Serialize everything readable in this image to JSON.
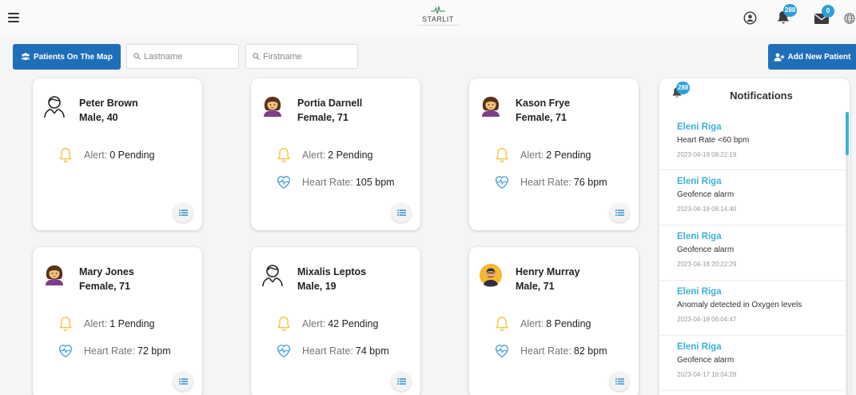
{
  "app": {
    "logo_text": "STARLIT"
  },
  "header": {
    "notifications_count": "288",
    "messages_count": "0"
  },
  "toolbar": {
    "map_button_label": "Patients On The Map",
    "lastname_placeholder": "Lastname",
    "firstname_placeholder": "Firstname",
    "add_patient_label": "Add New Patient"
  },
  "labels": {
    "alert": "Alert:",
    "heart_rate": "Heart Rate:"
  },
  "patients": [
    {
      "name": "Peter Brown",
      "gender_age": "Male, 40",
      "avatar": "outline-user-icon",
      "alert": "0 Pending",
      "heart_rate": ""
    },
    {
      "name": "Portia Darnell",
      "gender_age": "Female, 71",
      "avatar": "female-avatar-icon",
      "alert": "2 Pending",
      "heart_rate": "105 bpm"
    },
    {
      "name": "Kason Frye",
      "gender_age": "Female, 71",
      "avatar": "female-avatar-icon",
      "alert": "2 Pending",
      "heart_rate": "76 bpm"
    },
    {
      "name": "Mary Jones",
      "gender_age": "Female, 71",
      "avatar": "female-avatar-icon",
      "alert": "1 Pending",
      "heart_rate": "72 bpm"
    },
    {
      "name": "Mixalis Leptos",
      "gender_age": "Male, 19",
      "avatar": "outline-user-icon",
      "alert": "42 Pending",
      "heart_rate": "74 bpm"
    },
    {
      "name": "Henry Murray",
      "gender_age": "Male, 71",
      "avatar": "male-avatar-icon",
      "alert": "8 Pending",
      "heart_rate": "82 bpm"
    }
  ],
  "notifications": {
    "title": "Notifications",
    "count": "288",
    "items": [
      {
        "name": "Eleni Riga",
        "message": "Heart Rate <60 bpm",
        "time": "2023-04-19 08:22:19"
      },
      {
        "name": "Eleni Riga",
        "message": "Geofence alarm",
        "time": "2023-04-19 08:14:40"
      },
      {
        "name": "Eleni Riga",
        "message": "Geofence alarm",
        "time": "2023-04-18 20:22:29"
      },
      {
        "name": "Eleni Riga",
        "message": "Anomaly detected in Oxygen levels",
        "time": "2023-04-18 06:04:47"
      },
      {
        "name": "Eleni Riga",
        "message": "Geofence alarm",
        "time": "2023-04-17 19:04:28"
      }
    ]
  },
  "colors": {
    "primary": "#1f6fb8",
    "accent": "#3cb1dc",
    "badge": "#2e9fd8",
    "alert": "#f2c84b"
  }
}
